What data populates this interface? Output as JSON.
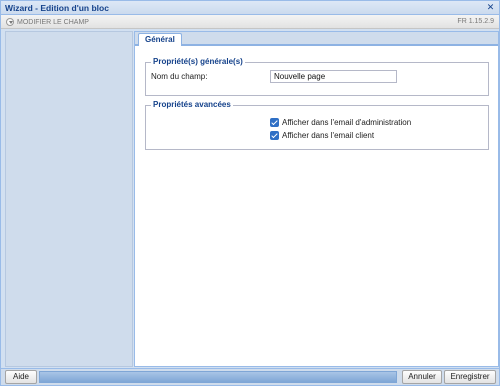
{
  "window": {
    "title": "Wizard - Edition d'un bloc",
    "close_glyph": "✕"
  },
  "toolbar": {
    "modify_label": "MODIFIER LE CHAMP",
    "version": "FR 1.15.2.9"
  },
  "tabs": [
    {
      "label": "Général",
      "active": true
    }
  ],
  "general_props": {
    "legend": "Propriété(s) générale(s)",
    "field_name_label": "Nom du champ:",
    "field_name_value": "Nouvelle page"
  },
  "advanced_props": {
    "legend": "Propriétés avancées",
    "options": [
      {
        "label": "Afficher dans l'email d'administration",
        "checked": true
      },
      {
        "label": "Afficher dans l'email client",
        "checked": true
      }
    ]
  },
  "footer": {
    "help_label": "Aide",
    "cancel_label": "Annuler",
    "save_label": "Enregistrer"
  },
  "colors": {
    "accent": "#15428b",
    "checkbox": "#2f6fc5",
    "frame": "#99bbe8"
  }
}
